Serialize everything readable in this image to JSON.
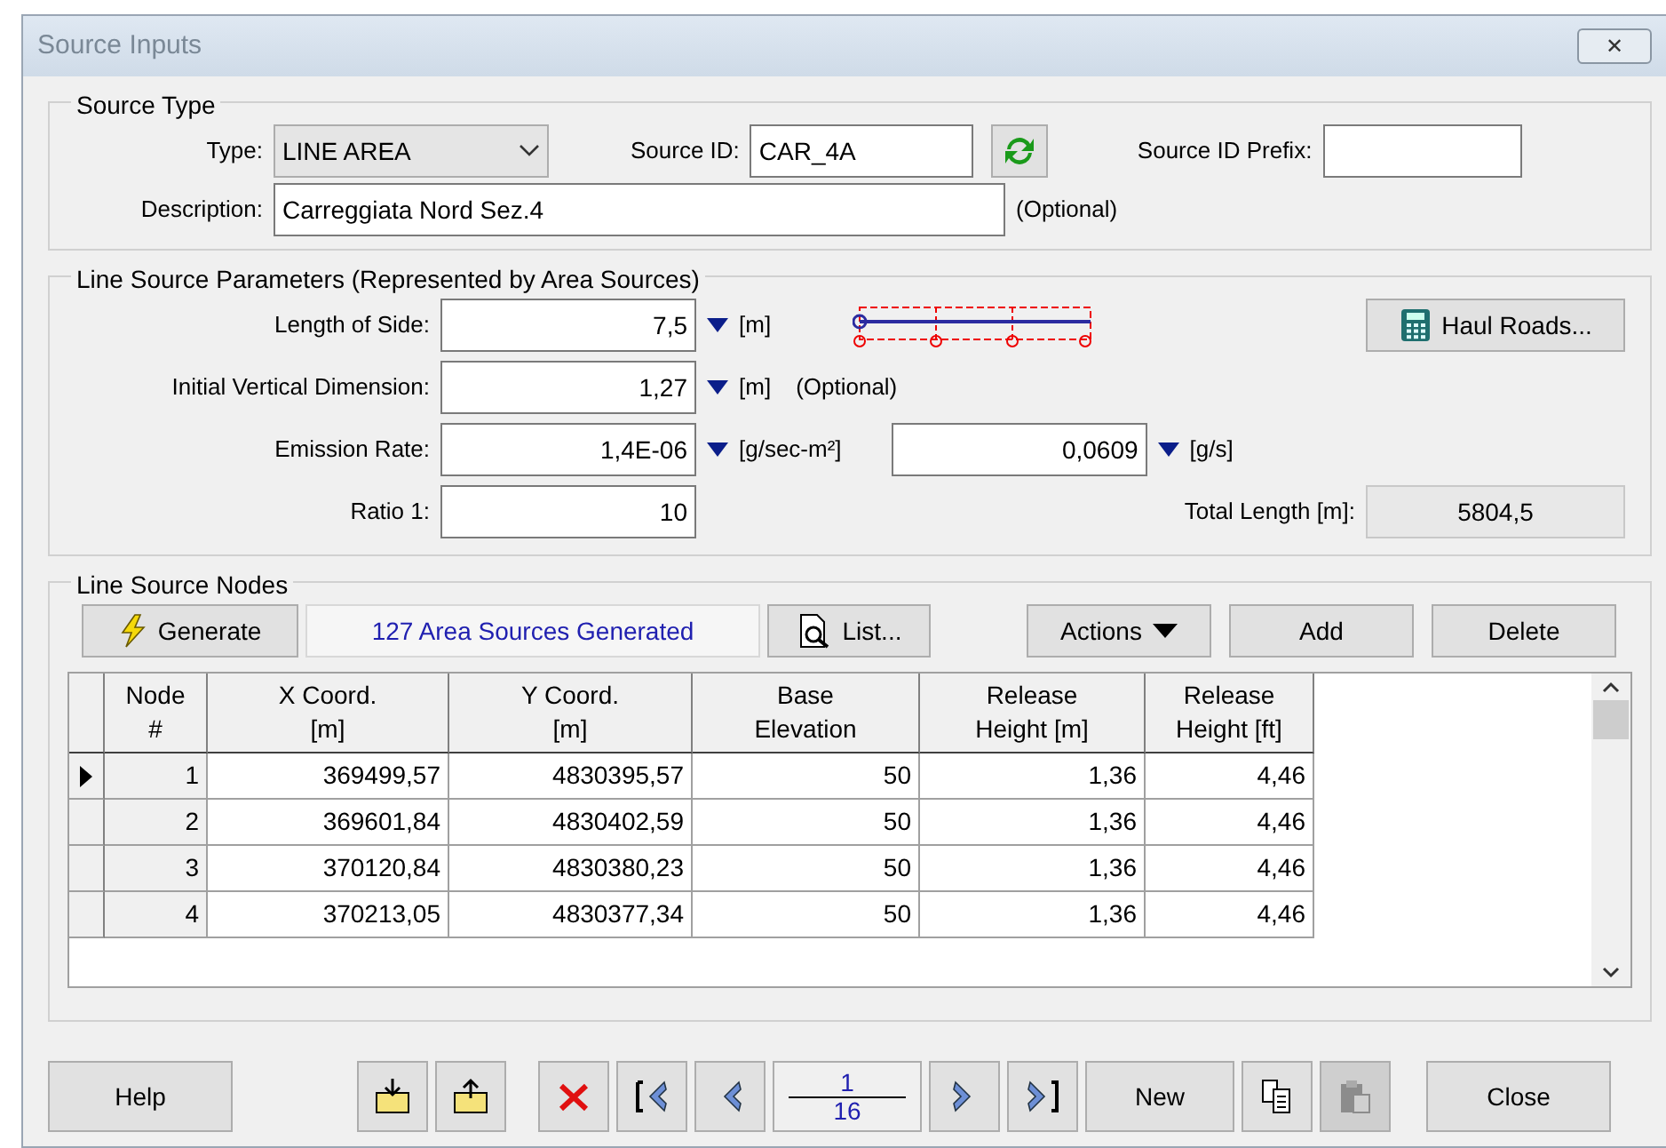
{
  "window": {
    "title": "Source Inputs",
    "close": "✕"
  },
  "source_type": {
    "legend": "Source Type",
    "type_label": "Type:",
    "type_value": "LINE AREA",
    "source_id_label": "Source ID:",
    "source_id_value": "CAR_4A",
    "prefix_label": "Source ID Prefix:",
    "description_label": "Description:",
    "description_value": "Carreggiata Nord Sez.4",
    "optional": "(Optional)"
  },
  "line_params": {
    "legend": "Line Source Parameters (Represented by Area Sources)",
    "length": {
      "label": "Length of Side:",
      "value": "7,5",
      "unit": "[m]"
    },
    "vertical": {
      "label": "Initial Vertical Dimension:",
      "value": "1,27",
      "unit": "[m]",
      "note": "(Optional)"
    },
    "emission": {
      "label": "Emission Rate:",
      "value": "1,4E-06",
      "unit": "[g/sec-m²]",
      "value2": "0,0609",
      "unit2": "[g/s]"
    },
    "ratio": {
      "label": "Ratio 1:",
      "value": "10"
    },
    "total": {
      "label": "Total Length [m]:",
      "value": "5804,5"
    },
    "haul_roads": "Haul Roads..."
  },
  "nodes": {
    "legend": "Line Source Nodes",
    "generate": "Generate",
    "status": "127 Area Sources Generated",
    "list": "List...",
    "actions": "Actions",
    "add": "Add",
    "delete": "Delete",
    "columns": [
      "Node\n#",
      "X Coord.\n[m]",
      "Y Coord.\n[m]",
      "Base\nElevation",
      "Release\nHeight [m]",
      "Release\nHeight [ft]"
    ],
    "rows": [
      {
        "current": true,
        "cells": [
          "1",
          "369499,57",
          "4830395,57",
          "50",
          "1,36",
          "4,46"
        ]
      },
      {
        "current": false,
        "cells": [
          "2",
          "369601,84",
          "4830402,59",
          "50",
          "1,36",
          "4,46"
        ]
      },
      {
        "current": false,
        "cells": [
          "3",
          "370120,84",
          "4830380,23",
          "50",
          "1,36",
          "4,46"
        ]
      },
      {
        "current": false,
        "cells": [
          "4",
          "370213,05",
          "4830377,34",
          "50",
          "1,36",
          "4,46"
        ]
      }
    ]
  },
  "footer": {
    "buttons": [
      {
        "kind": "text",
        "label": "Help",
        "disabled": false
      },
      {
        "kind": "import",
        "disabled": false
      },
      {
        "kind": "export",
        "disabled": false
      },
      {
        "kind": "delete",
        "disabled": false
      },
      {
        "kind": "first",
        "disabled": false
      },
      {
        "kind": "prev",
        "disabled": false
      },
      {
        "kind": "pager",
        "current": "1",
        "total": "16"
      },
      {
        "kind": "next",
        "disabled": false
      },
      {
        "kind": "last",
        "disabled": false
      },
      {
        "kind": "text",
        "label": "New",
        "disabled": false
      },
      {
        "kind": "copy",
        "disabled": false
      },
      {
        "kind": "paste",
        "disabled": true
      },
      {
        "kind": "text",
        "label": "Close",
        "disabled": false
      }
    ]
  }
}
